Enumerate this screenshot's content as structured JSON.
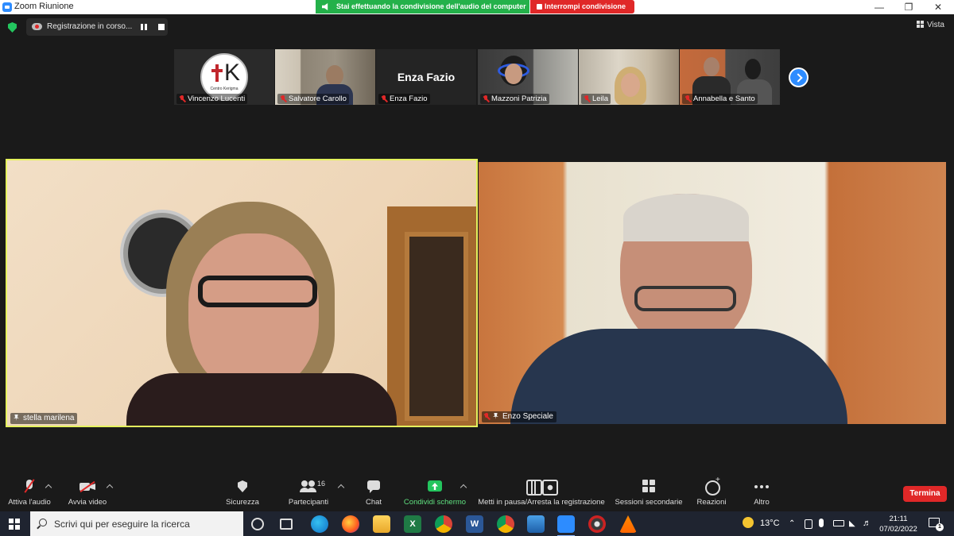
{
  "window": {
    "title": "Zoom Riunione",
    "share_banner": "Stai effettuando la condivisione dell'audio del computer",
    "stop_share": "Interrompi condivisione"
  },
  "topbar": {
    "recording_label": "Registrazione in corso...",
    "view_label": "Vista"
  },
  "thumbnails": [
    {
      "name": "Vincenzo Lucenti",
      "muted": true,
      "logo_letter": "K",
      "logo_subtitle": "Centro Kerigma"
    },
    {
      "name": "Salvatore Carollo",
      "muted": true
    },
    {
      "name": "Enza Fazio",
      "muted": true,
      "display_text": "Enza Fazio"
    },
    {
      "name": "Mazzoni Patrizia",
      "muted": true
    },
    {
      "name": "Leila",
      "muted": true
    },
    {
      "name": "Annabella e Santo",
      "muted": true
    }
  ],
  "tiles": [
    {
      "name": "stella marilena",
      "pinned": true,
      "active_speaker": true
    },
    {
      "name": "Enzo Speciale",
      "pinned": true,
      "muted": true
    }
  ],
  "toolbar": {
    "audio": "Attiva l'audio",
    "video": "Avvia video",
    "security": "Sicurezza",
    "participants": "Partecipanti",
    "participants_count": "16",
    "chat": "Chat",
    "share": "Condividi schermo",
    "recording": "Metti in pausa/Arresta la registrazione",
    "rooms": "Sessioni secondarie",
    "reactions": "Reazioni",
    "more": "Altro",
    "end": "Termina"
  },
  "taskbar": {
    "search_placeholder": "Scrivi qui per eseguire la ricerca",
    "weather": "13°C",
    "time": "21:11",
    "date": "07/02/2022",
    "notification_count": "1"
  },
  "colors": {
    "zoom_blue": "#2d8cff",
    "share_green": "#24b14a",
    "stop_red": "#e02828",
    "speaker_border": "#e5f25e"
  }
}
